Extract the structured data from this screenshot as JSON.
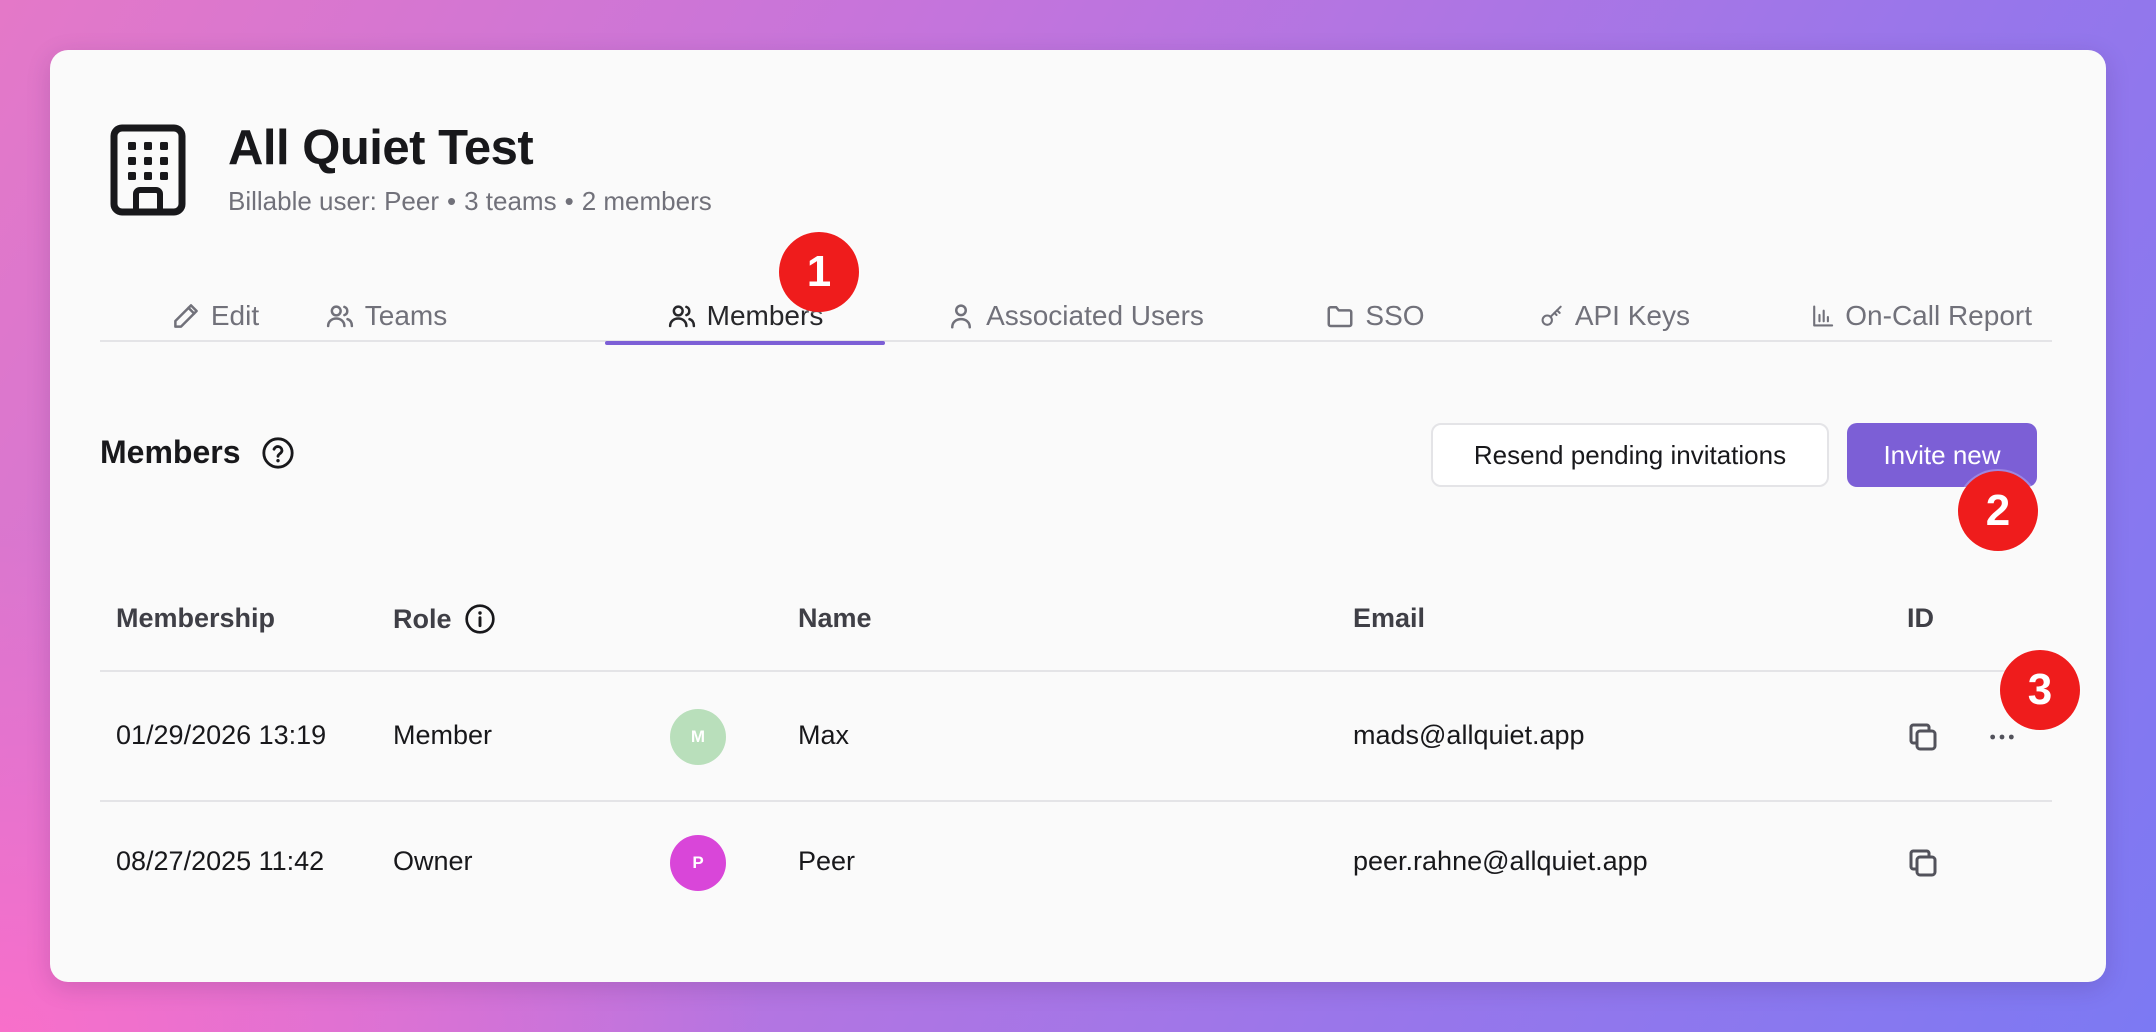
{
  "org": {
    "title": "All Quiet Test",
    "billable": "Billable user: Peer",
    "teams": "3 teams",
    "members": "2 members",
    "icon": "building-icon"
  },
  "tabs": [
    {
      "label": "Edit",
      "icon": "pencil-icon"
    },
    {
      "label": "Teams",
      "icon": "users-icon"
    },
    {
      "label": "Members",
      "icon": "users-icon",
      "active": true
    },
    {
      "label": "Associated Users",
      "icon": "user-icon"
    },
    {
      "label": "SSO",
      "icon": "folder-icon"
    },
    {
      "label": "API Keys",
      "icon": "key-icon"
    },
    {
      "label": "On-Call Report",
      "icon": "bar-chart-icon"
    }
  ],
  "section": {
    "title": "Members",
    "resend_label": "Resend pending invitations",
    "invite_label": "Invite new"
  },
  "table": {
    "headers": [
      "Membership",
      "Role",
      "Name",
      "Email",
      "ID"
    ],
    "rows": [
      {
        "membership": "01/29/2026 13:19",
        "role": "Member",
        "avatar": "M",
        "avatar_color": "#b9dfbb",
        "name": "Max",
        "email": "mads@allquiet.app",
        "has_menu": true
      },
      {
        "membership": "08/27/2025 11:42",
        "role": "Owner",
        "avatar": "P",
        "avatar_color": "#d946d9",
        "name": "Peer",
        "email": "peer.rahne@allquiet.app",
        "has_menu": false
      }
    ]
  },
  "markers": [
    "1",
    "2",
    "3"
  ],
  "colors": {
    "accent": "#7c5fd6",
    "marker": "#ef1c1c"
  }
}
